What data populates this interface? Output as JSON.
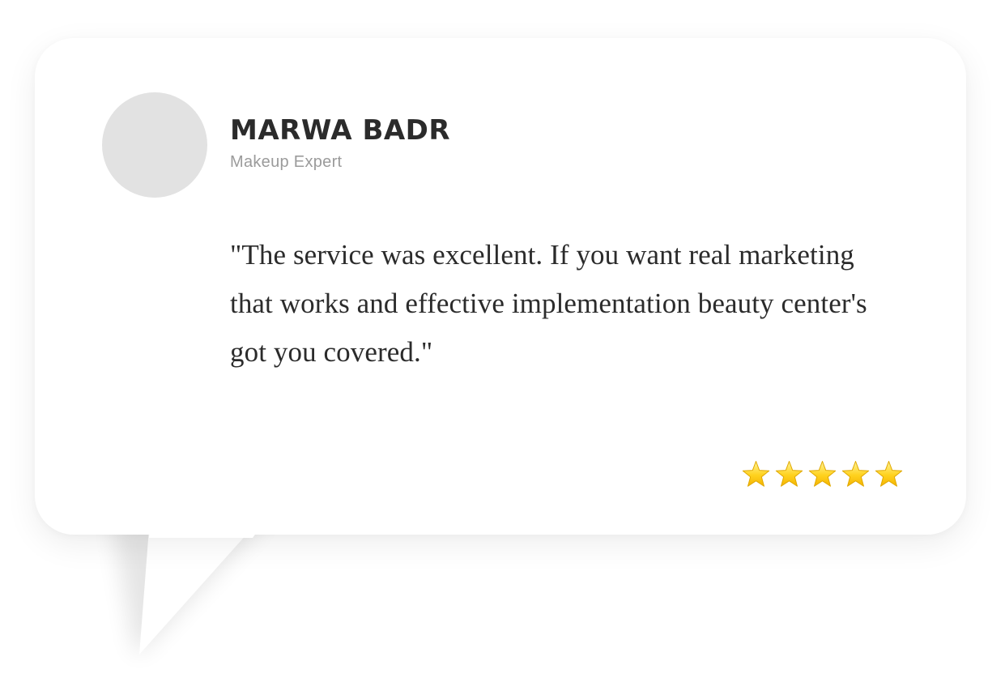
{
  "reviewer": {
    "name": "MARWA BADR",
    "role": "Makeup Expert"
  },
  "review": {
    "text": "\"The service was excellent. If you want real marketing that works and effective implementation beauty center's got you covered.\""
  },
  "rating": {
    "value": 5,
    "max": 5,
    "star_icon": "star-icon",
    "star_fill": "#FFD21F",
    "star_stroke": "#E0A800"
  },
  "colors": {
    "card_bg": "#FFFFFF",
    "avatar_placeholder": "#E2E2E2",
    "name_text": "#2B2B2B",
    "role_text": "#9B9B9B"
  }
}
